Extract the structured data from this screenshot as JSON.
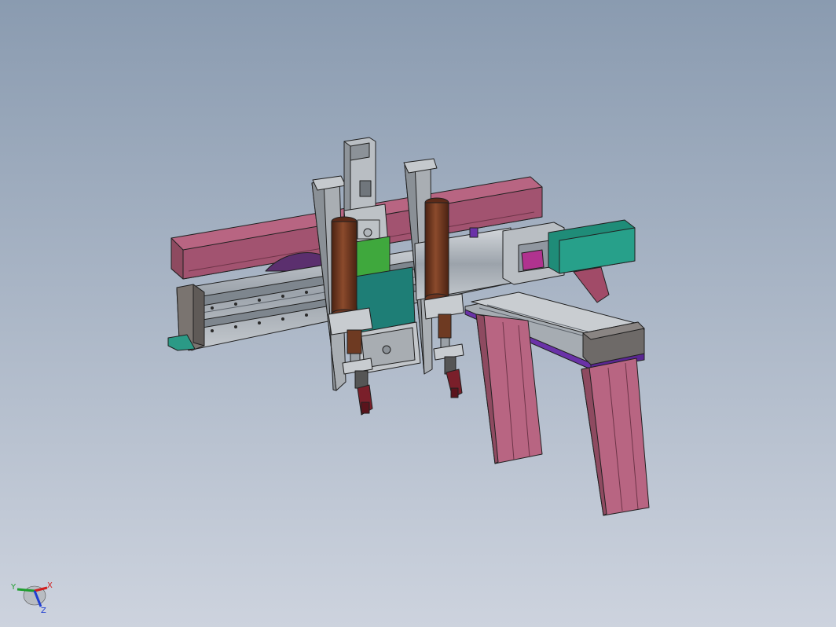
{
  "viewport": {
    "background_top": "#8A9BB0",
    "background_bottom": "#CDD3DE"
  },
  "model": {
    "colors": {
      "frame_pink": "#B45E78",
      "frame_pink_dark": "#8E4A60",
      "rail_grey": "#9CA3AB",
      "rail_light": "#C7CCD1",
      "plate_dark_grey": "#6E6A68",
      "teal": "#1F8C78",
      "green": "#37A63A",
      "brown_cylinder": "#7A3C24",
      "purple": "#6A32A8",
      "magenta": "#B0338F",
      "gripper_red": "#7A1F2A",
      "outline": "#202020"
    }
  },
  "triad": {
    "x_label": "X",
    "y_label": "Y",
    "z_label": "Z",
    "x_color": "#D11F1F",
    "y_color": "#1F9E2F",
    "z_color": "#1F3ED1"
  }
}
